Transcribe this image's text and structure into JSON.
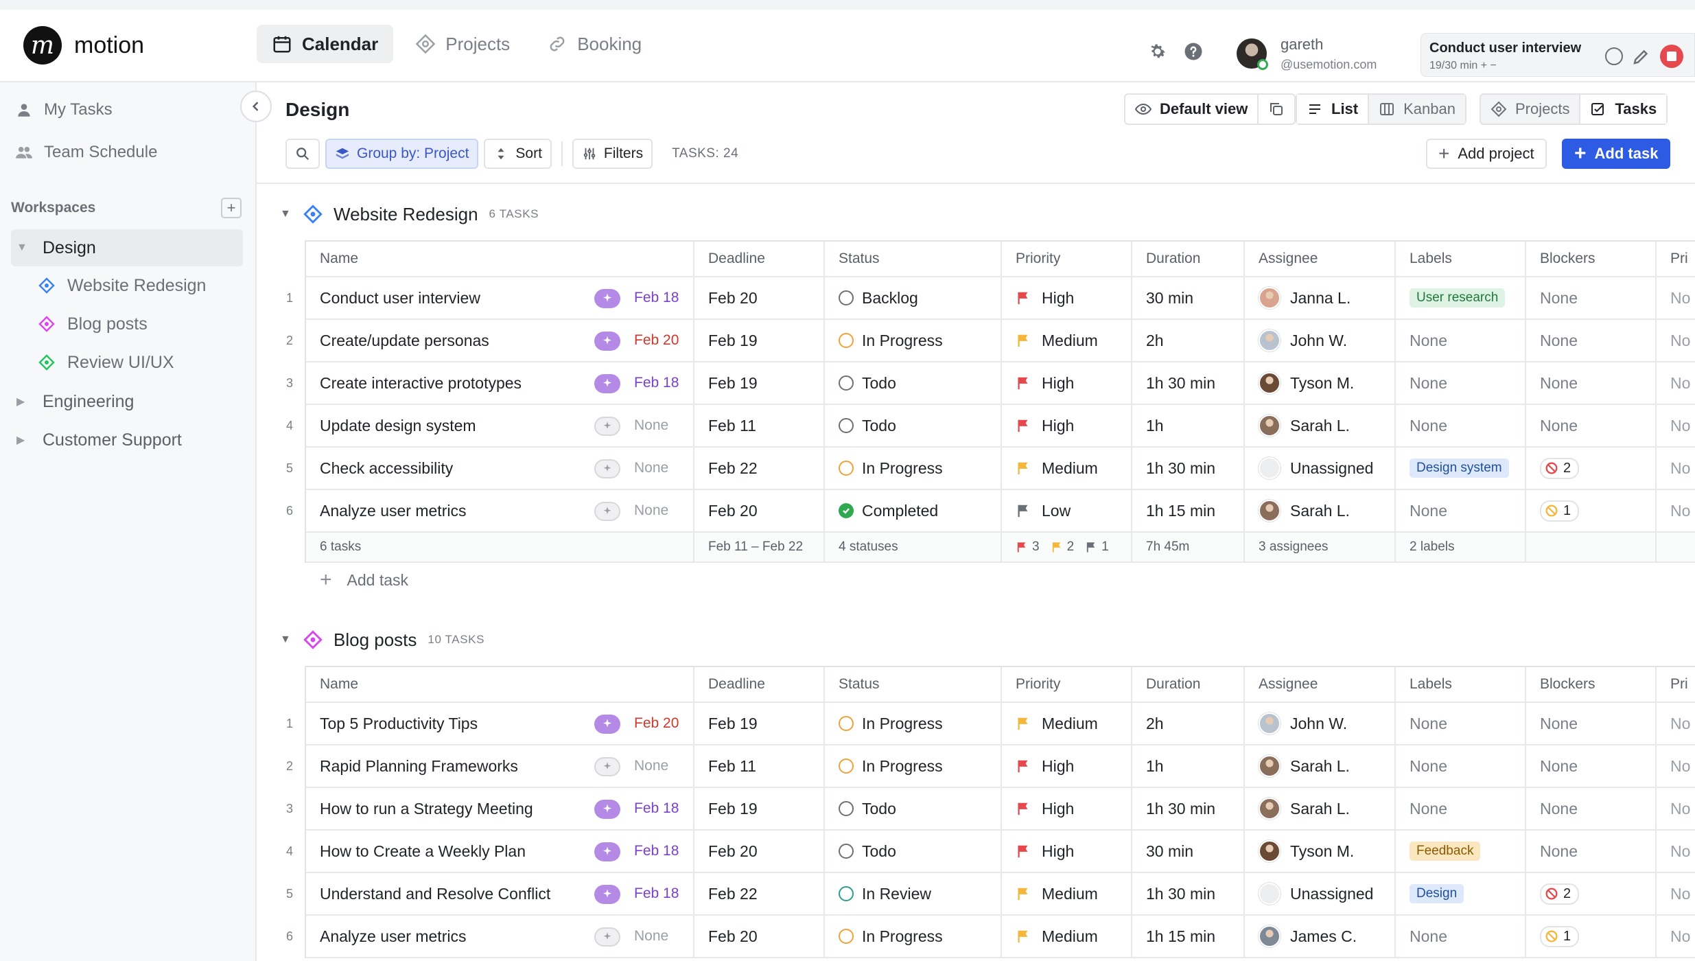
{
  "app": {
    "name": "motion",
    "logo_letter": "m"
  },
  "topnav": [
    {
      "label": "Calendar",
      "icon": "calendar-icon",
      "active": true
    },
    {
      "label": "Projects",
      "icon": "projects-icon",
      "active": false
    },
    {
      "label": "Booking",
      "icon": "link-icon",
      "active": false
    }
  ],
  "user": {
    "name": "gareth",
    "email": "@usemotion.com"
  },
  "active_task": {
    "title": "Conduct user interview",
    "progress": "19/30 min",
    "controls": "+ −"
  },
  "sidebar": {
    "my_tasks": "My Tasks",
    "team_schedule": "Team Schedule",
    "workspaces_label": "Workspaces",
    "workspaces": [
      {
        "name": "Design",
        "expanded": true,
        "projects": [
          {
            "name": "Website Redesign",
            "color": "#3b82f6"
          },
          {
            "name": "Blog posts",
            "color": "#d946ef"
          },
          {
            "name": "Review UI/UX",
            "color": "#22c55e"
          }
        ]
      },
      {
        "name": "Engineering",
        "expanded": false
      },
      {
        "name": "Customer Support",
        "expanded": false
      }
    ]
  },
  "page": {
    "title": "Design",
    "default_view": "Default view",
    "view_list": "List",
    "view_kanban": "Kanban",
    "view_projects": "Projects",
    "view_tasks": "Tasks",
    "group_by": "Group by: Project",
    "sort": "Sort",
    "filters": "Filters",
    "task_count": "TASKS: 24",
    "add_project": "Add project",
    "add_task": "Add task"
  },
  "columns": [
    "Name",
    "Deadline",
    "Status",
    "Priority",
    "Duration",
    "Assignee",
    "Labels",
    "Blockers",
    "Pri"
  ],
  "colors": {
    "priority_high": "#e5484d",
    "priority_medium": "#f5b73b",
    "priority_low": "#6b7078",
    "accent": "#2d5be3",
    "ai_purple": "#b58ae6"
  },
  "groups": [
    {
      "name": "Website Redesign",
      "count_label": "6 TASKS",
      "icon_color": "#3b82f6",
      "tasks": [
        {
          "num": "1",
          "name": "Conduct user interview",
          "ai": true,
          "ai_date": "Feb 18",
          "ai_date_style": "purple",
          "deadline": "Feb 20",
          "status": "Backlog",
          "status_kind": "backlog",
          "priority": "High",
          "duration": "30 min",
          "assignee": "Janna L.",
          "avatar": "#d9a48f",
          "labels": "User research",
          "label_bg": "#dff3e4",
          "label_fg": "#1f7a3a",
          "blockers": "None",
          "blocker_kind": "none",
          "pr": "No"
        },
        {
          "num": "2",
          "name": "Create/update personas",
          "ai": true,
          "ai_date": "Feb 20",
          "ai_date_style": "red",
          "deadline": "Feb 19",
          "status": "In Progress",
          "status_kind": "progress",
          "priority": "Medium",
          "duration": "2h",
          "assignee": "John W.",
          "avatar": "#b9c3cf",
          "labels": "None",
          "blockers": "None",
          "blocker_kind": "none",
          "pr": "No"
        },
        {
          "num": "3",
          "name": "Create interactive prototypes",
          "ai": true,
          "ai_date": "Feb 18",
          "ai_date_style": "purple",
          "deadline": "Feb 19",
          "status": "Todo",
          "status_kind": "todo",
          "priority": "High",
          "duration": "1h 30 min",
          "assignee": "Tyson M.",
          "avatar": "#6b4a35",
          "labels": "None",
          "blockers": "None",
          "blocker_kind": "none",
          "pr": "No"
        },
        {
          "num": "4",
          "name": "Update design system",
          "ai": false,
          "ai_date": "None",
          "ai_date_style": "none",
          "deadline": "Feb 11",
          "status": "Todo",
          "status_kind": "todo",
          "priority": "High",
          "duration": "1h",
          "assignee": "Sarah L.",
          "avatar": "#8b6d5c",
          "labels": "None",
          "blockers": "None",
          "blocker_kind": "none",
          "pr": "No"
        },
        {
          "num": "5",
          "name": "Check accessibility",
          "ai": false,
          "ai_date": "None",
          "ai_date_style": "none",
          "deadline": "Feb 22",
          "status": "In Progress",
          "status_kind": "progress",
          "priority": "Medium",
          "duration": "1h 30 min",
          "assignee": "Unassigned",
          "avatar": "#e4e6e9",
          "labels": "Design system",
          "label_bg": "#dde9fb",
          "label_fg": "#1f4f9e",
          "blockers": "2",
          "blocker_kind": "blocked",
          "pr": "No"
        },
        {
          "num": "6",
          "name": "Analyze user metrics",
          "ai": false,
          "ai_date": "None",
          "ai_date_style": "none",
          "deadline": "Feb 20",
          "status": "Completed",
          "status_kind": "done",
          "priority": "Low",
          "duration": "1h 15 min",
          "assignee": "Sarah L.",
          "avatar": "#8b6d5c",
          "labels": "None",
          "blockers": "1",
          "blocker_kind": "blocking",
          "pr": "No"
        }
      ],
      "footer": {
        "tasks": "6 tasks",
        "deadline": "Feb 11 – Feb 22",
        "statuses": "4 statuses",
        "high": "3",
        "medium": "2",
        "low": "1",
        "duration": "7h 45m",
        "assignees": "3 assignees",
        "labels": "2 labels"
      },
      "add_task": "Add task"
    },
    {
      "name": "Blog posts",
      "count_label": "10 TASKS",
      "icon_color": "#d946ef",
      "tasks": [
        {
          "num": "1",
          "name": "Top 5 Productivity Tips",
          "ai": true,
          "ai_date": "Feb 20",
          "ai_date_style": "red",
          "deadline": "Feb 19",
          "status": "In Progress",
          "status_kind": "progress",
          "priority": "Medium",
          "duration": "2h",
          "assignee": "John W.",
          "avatar": "#b9c3cf",
          "labels": "None",
          "blockers": "None",
          "blocker_kind": "none",
          "pr": "No"
        },
        {
          "num": "2",
          "name": "Rapid Planning Frameworks",
          "ai": false,
          "ai_date": "None",
          "ai_date_style": "none",
          "deadline": "Feb 11",
          "status": "In Progress",
          "status_kind": "progress",
          "priority": "High",
          "duration": "1h",
          "assignee": "Sarah L.",
          "avatar": "#8b6d5c",
          "labels": "None",
          "blockers": "None",
          "blocker_kind": "none",
          "pr": "No"
        },
        {
          "num": "3",
          "name": "How to run a Strategy Meeting",
          "ai": true,
          "ai_date": "Feb 18",
          "ai_date_style": "purple",
          "deadline": "Feb 19",
          "status": "Todo",
          "status_kind": "todo",
          "priority": "High",
          "duration": "1h 30 min",
          "assignee": "Sarah L.",
          "avatar": "#8b6d5c",
          "labels": "None",
          "blockers": "None",
          "blocker_kind": "none",
          "pr": "No"
        },
        {
          "num": "4",
          "name": "How to Create a Weekly Plan",
          "ai": true,
          "ai_date": "Feb 18",
          "ai_date_style": "purple",
          "deadline": "Feb 20",
          "status": "Todo",
          "status_kind": "todo",
          "priority": "High",
          "duration": "30 min",
          "assignee": "Tyson M.",
          "avatar": "#6b4a35",
          "labels": "Feedback",
          "label_bg": "#fbe7bf",
          "label_fg": "#8a5a00",
          "blockers": "None",
          "blocker_kind": "none",
          "pr": "No"
        },
        {
          "num": "5",
          "name": "Understand and Resolve Conflict",
          "ai": true,
          "ai_date": "Feb 18",
          "ai_date_style": "purple",
          "deadline": "Feb 22",
          "status": "In Review",
          "status_kind": "review",
          "priority": "Medium",
          "duration": "1h 30 min",
          "assignee": "Unassigned",
          "avatar": "#e4e6e9",
          "labels": "Design",
          "label_bg": "#dde9fb",
          "label_fg": "#1f4f9e",
          "blockers": "2",
          "blocker_kind": "blocked",
          "pr": "No"
        },
        {
          "num": "6",
          "name": "Analyze user metrics",
          "ai": false,
          "ai_date": "None",
          "ai_date_style": "none",
          "deadline": "Feb 20",
          "status": "In Progress",
          "status_kind": "progress",
          "priority": "Medium",
          "duration": "1h 15 min",
          "assignee": "James C.",
          "avatar": "#7d8a96",
          "labels": "None",
          "blockers": "1",
          "blocker_kind": "blocking",
          "pr": "No"
        }
      ]
    }
  ]
}
